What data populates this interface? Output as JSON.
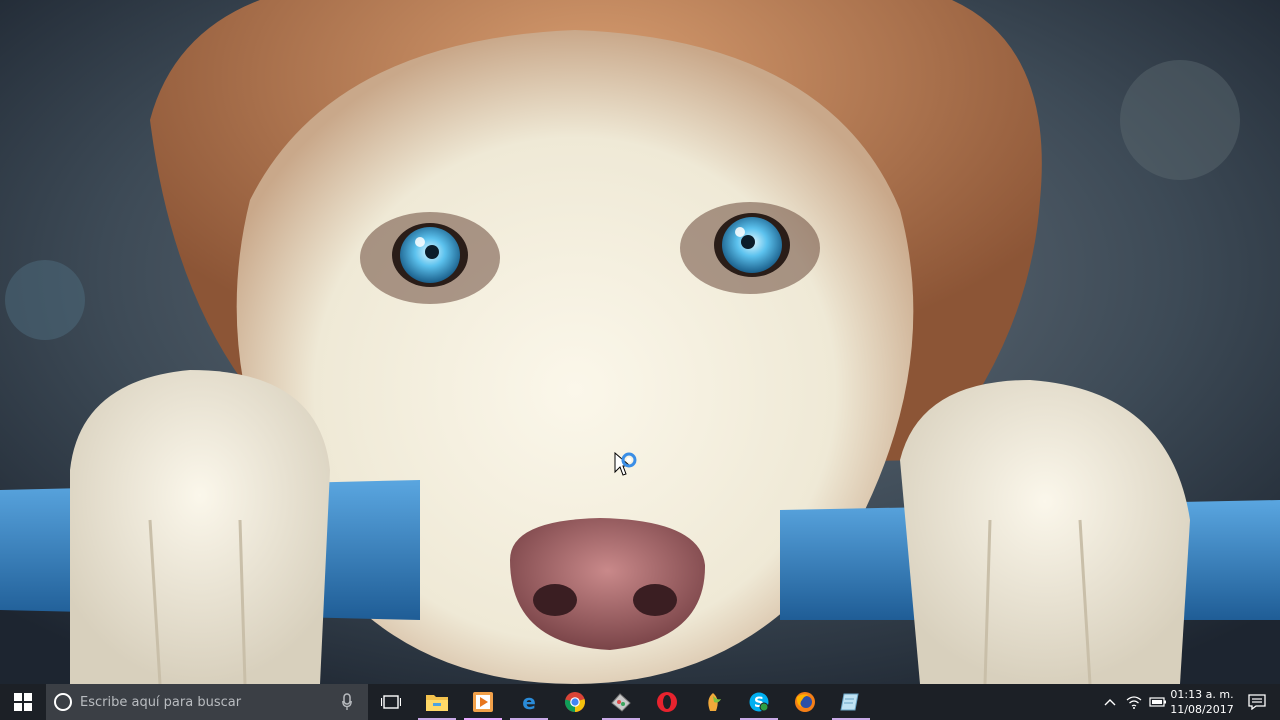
{
  "desktop": {
    "wallpaper": "husky-dog-photo"
  },
  "taskbar": {
    "start_icon": "windows-logo-icon",
    "search": {
      "placeholder": "Escribe aquí para buscar"
    },
    "apps": [
      {
        "name": "file-explorer-icon",
        "running": true
      },
      {
        "name": "media-player-icon",
        "running": true,
        "active": true
      },
      {
        "name": "edge-icon",
        "running": true
      },
      {
        "name": "chrome-icon",
        "running": false
      },
      {
        "name": "paint-tool-icon",
        "running": true
      },
      {
        "name": "opera-icon",
        "running": false
      },
      {
        "name": "fl-studio-icon",
        "running": false
      },
      {
        "name": "skype-icon",
        "running": true
      },
      {
        "name": "firefox-icon",
        "running": false
      },
      {
        "name": "notes-app-icon",
        "running": true
      }
    ],
    "clock": {
      "time": "01:13 a. m.",
      "date": "11/08/2017"
    }
  },
  "colors": {
    "taskbar_bg": "#1c2026",
    "search_bg": "#3b3f45",
    "running_indicator": "#c9a9e6"
  }
}
